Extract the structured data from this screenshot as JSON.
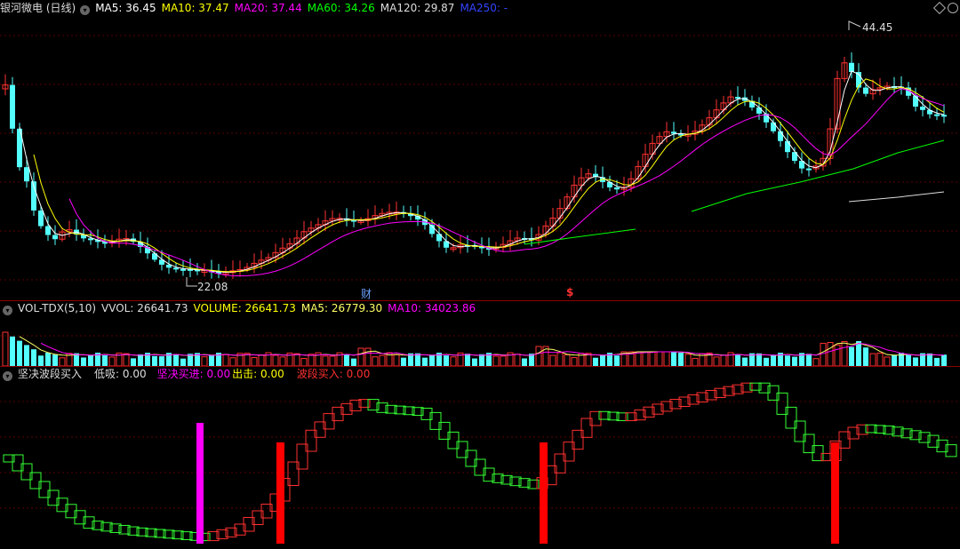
{
  "price_header": {
    "title": "银河微电 (日线)",
    "ma": [
      {
        "label": "MA5: 36.45",
        "color": "#ffffff"
      },
      {
        "label": "MA10: 37.47",
        "color": "#ffff00"
      },
      {
        "label": "MA20: 37.44",
        "color": "#ff00ff"
      },
      {
        "label": "MA60: 34.26",
        "color": "#00ff00"
      },
      {
        "label": "MA120: 29.87",
        "color": "#dddddd"
      },
      {
        "label": "MA250: -",
        "color": "#3344ff"
      }
    ],
    "high_label": "44.45",
    "low_label": "22.08",
    "marker_cai": "财",
    "marker_dollar": "$"
  },
  "vol_header": {
    "title": "VOL-TDX(5,10)",
    "items": [
      {
        "label": "VVOL: 26641.73",
        "color": "#dddddd"
      },
      {
        "label": "VOLUME: 26641.73",
        "color": "#ffff00"
      },
      {
        "label": "MA5: 26779.30",
        "color": "#ffff66"
      },
      {
        "label": "MA10: 34023.86",
        "color": "#ff00ff"
      }
    ]
  },
  "ind_header": {
    "title": "坚决波段买入",
    "items": [
      {
        "label": "低吸: 0.00",
        "color": "#dddddd"
      },
      {
        "label": "坚决买进: 0.00",
        "color": "#ff00ff"
      },
      {
        "label": "出击: 0.00",
        "color": "#ffff00"
      },
      {
        "label": "波段买入: 0.00",
        "color": "#ff3030"
      }
    ]
  },
  "colors": {
    "up": "#ff3232",
    "down": "#54ffff",
    "grid": "#5a0000"
  }
}
